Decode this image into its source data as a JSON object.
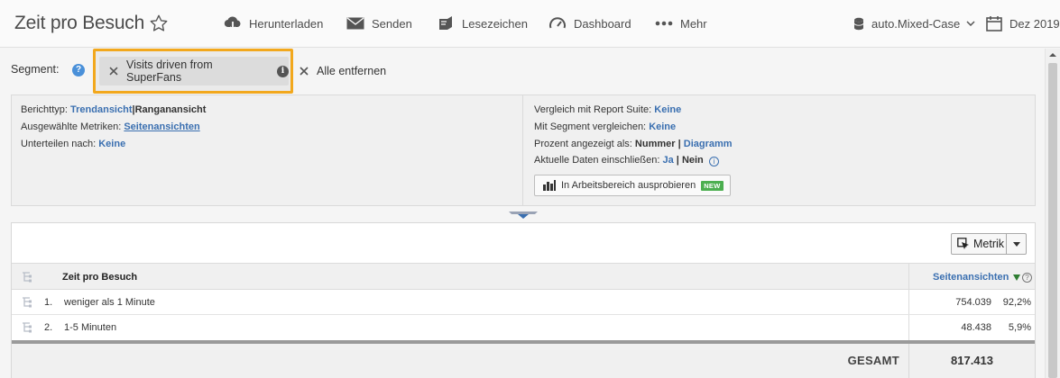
{
  "header": {
    "title": "Zeit pro Besuch",
    "toolbar": {
      "download": "Herunterladen",
      "send": "Senden",
      "bookmark": "Lesezeichen",
      "dashboard": "Dashboard",
      "more": "Mehr"
    },
    "report_suite": "auto.Mixed-Case",
    "date": "Dez 2019"
  },
  "segment_bar": {
    "label": "Segment:",
    "help_glyph": "?",
    "chip": "Visits driven from SuperFans",
    "chip_info_glyph": "i",
    "remove_all": "Alle entfernen"
  },
  "info_panel": {
    "report_type_label": "Berichttyp:",
    "report_type_trend": "Trendansicht",
    "report_type_sep": "|",
    "report_type_ranked": "Ranganansicht",
    "metrics_label": "Ausgewählte Metriken:",
    "metrics_value": "Seitenansichten",
    "breakdown_label": "Unterteilen nach:",
    "breakdown_value": "Keine",
    "compare_suite_label": "Vergleich mit Report Suite:",
    "compare_suite_value": "Keine",
    "compare_segment_label": "Mit Segment vergleichen:",
    "compare_segment_value": "Keine",
    "percent_label": "Prozent angezeigt als:",
    "percent_number": "Nummer",
    "percent_sep": "|",
    "percent_chart": "Diagramm",
    "current_label": "Aktuelle Daten einschließen:",
    "current_yes": "Ja",
    "current_sep": "|",
    "current_no": "Nein",
    "current_info_glyph": "i",
    "try_workspace": "In Arbeitsbereich ausprobieren",
    "new_badge": "NEW"
  },
  "table": {
    "metric_button": "Metrik",
    "dimension_header": "Zeit pro Besuch",
    "metric_header": "Seitenansichten",
    "help_glyph": "?",
    "rows": [
      {
        "num": "1.",
        "label": "weniger als 1 Minute",
        "value": "754.039",
        "pct": "92,2%"
      },
      {
        "num": "2.",
        "label": "1-5 Minuten",
        "value": "48.438",
        "pct": "5,9%"
      }
    ],
    "total_label": "GESAMT",
    "total_value": "817.413"
  },
  "colors": {
    "highlight": "#f2a81d",
    "link": "#3a6fb0",
    "new_badge": "#4caf50",
    "sort_arrow": "#2e7d32"
  },
  "icons": [
    "star-icon",
    "download-cloud-icon",
    "envelope-icon",
    "bookmark-icon",
    "gauge-icon",
    "ellipsis-icon",
    "database-icon",
    "chevron-down-icon",
    "calendar-icon",
    "close-icon",
    "info-icon",
    "help-icon",
    "workspace-icon",
    "cursor-icon",
    "tree-icon",
    "scroll-up-icon"
  ]
}
